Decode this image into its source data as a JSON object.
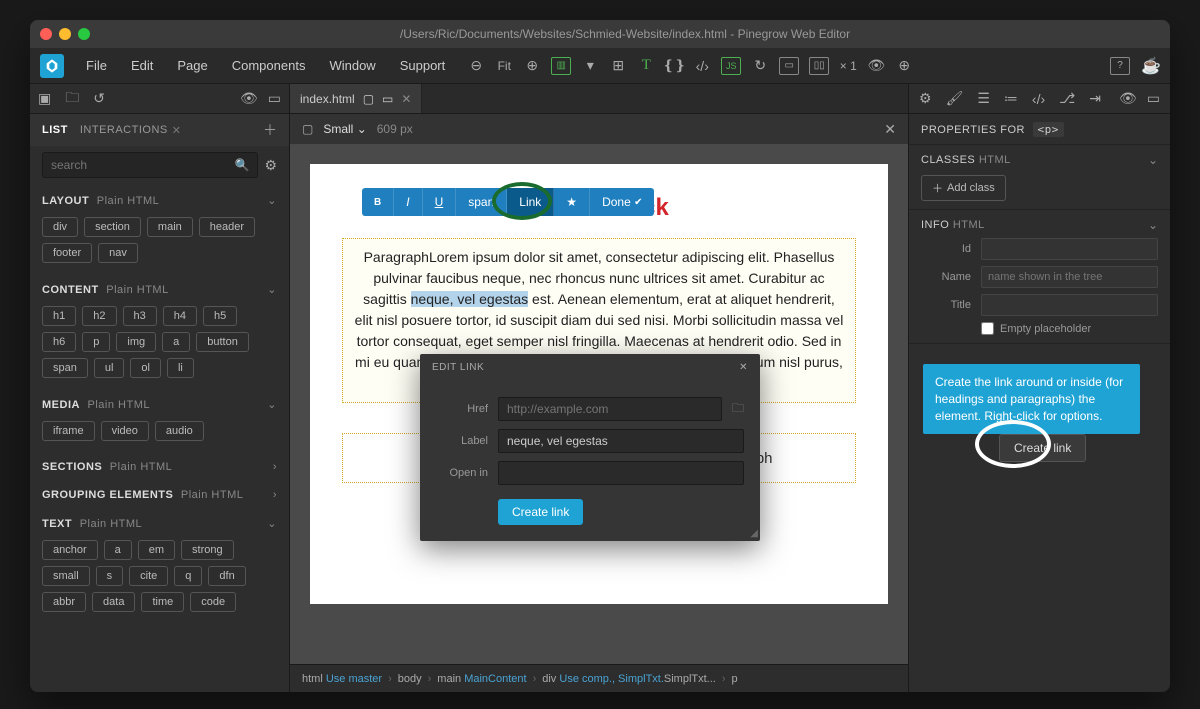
{
  "title": "/Users/Ric/Documents/Websites/Schmied-Website/index.html - Pinegrow Web Editor",
  "menu": {
    "file": "File",
    "edit": "Edit",
    "page": "Page",
    "components": "Components",
    "window": "Window",
    "support": "Support"
  },
  "toolbar": {
    "fit": "Fit",
    "zoom": "× 1"
  },
  "left": {
    "tabs": {
      "list": "LIST",
      "interactions": "INTERACTIONS"
    },
    "search_placeholder": "search",
    "layout": {
      "title": "LAYOUT",
      "sub": "Plain HTML",
      "tags": [
        "div",
        "section",
        "main",
        "header",
        "footer",
        "nav"
      ]
    },
    "content": {
      "title": "CONTENT",
      "sub": "Plain HTML",
      "tags": [
        "h1",
        "h2",
        "h3",
        "h4",
        "h5",
        "h6",
        "p",
        "img",
        "a",
        "button",
        "span",
        "ul",
        "ol",
        "li"
      ]
    },
    "media": {
      "title": "MEDIA",
      "sub": "Plain HTML",
      "tags": [
        "iframe",
        "video",
        "audio"
      ]
    },
    "sections": {
      "title": "SECTIONS",
      "sub": "Plain HTML"
    },
    "grouping": {
      "title": "GROUPING ELEMENTS",
      "sub": "Plain HTML"
    },
    "text": {
      "title": "TEXT",
      "sub": "Plain HTML",
      "tags": [
        "anchor",
        "a",
        "em",
        "strong",
        "small",
        "s",
        "cite",
        "q",
        "dfn",
        "abbr",
        "data",
        "time",
        "code"
      ]
    }
  },
  "center": {
    "tab": "index.html",
    "device": "Small",
    "width": "609 px",
    "heading": "er Textblock",
    "paragraph_pre": "ParagraphLorem ipsum dolor sit amet, consectetur adipiscing elit. Phasellus pulvinar faucibus neque, nec rhoncus nunc ultrices sit amet. Curabitur ac sagittis ",
    "paragraph_sel": "neque, vel egestas",
    "paragraph_post": " est. Aenean elementum, erat at aliquet hendrerit, elit nisl posuere tortor, id suscipit diam dui sed nisi. Morbi sollicitudin massa vel tortor consequat, eget semper nisl fringilla. Maecenas at hendrerit odio. Sed in mi eu quam suscipit bibendum quis at orci. Pellentesque fermentum nisl purus, et iaculis lectus pharetra sit amet.",
    "placeholder": "Paragraph",
    "edit_toolbar": {
      "b": "B",
      "i": "I",
      "u": "U",
      "span": "span",
      "link": "Link",
      "star": "★",
      "done": "Done",
      "check": "✔"
    },
    "breadcrumb": {
      "html": "html",
      "html_link": "Use master",
      "body": "body",
      "main": "main",
      "main_link": "MainContent",
      "div": "div",
      "div_link": "Use comp., SimplTxt.",
      "div_after": "SimplTxt...",
      "p": "p"
    }
  },
  "modal": {
    "title": "EDIT LINK",
    "href_label": "Href",
    "href_placeholder": "http://example.com",
    "label_label": "Label",
    "label_value": "neque, vel egestas",
    "openin_label": "Open in",
    "button": "Create link"
  },
  "right": {
    "prop_for": "PROPERTIES FOR",
    "prop_tag": "<p>",
    "classes": "CLASSES",
    "classes_sub": "HTML",
    "add_class": "Add class",
    "info": "INFO",
    "info_sub": "HTML",
    "id_label": "Id",
    "name_label": "Name",
    "name_placeholder": "name shown in the tree",
    "title_label": "Title",
    "empty_placeholder": "Empty placeholder",
    "tooltip": "Create the link around or inside (for headings and paragraphs) the element. Right-click for options.",
    "create_link": "Create link"
  }
}
